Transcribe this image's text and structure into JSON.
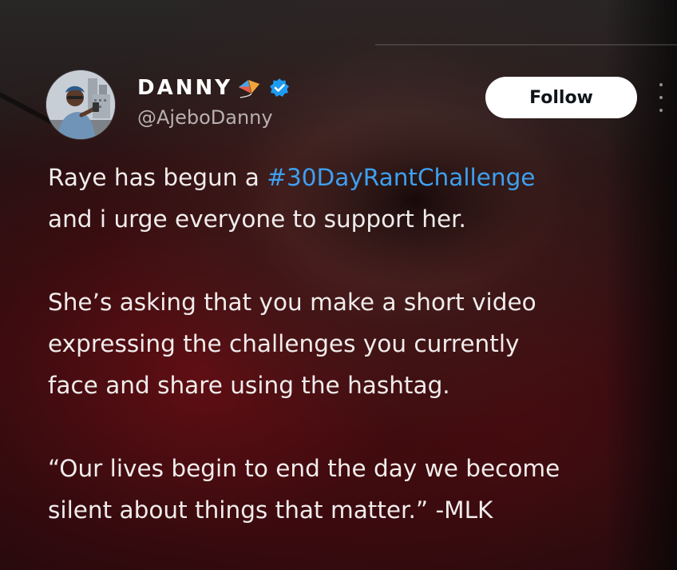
{
  "tweet": {
    "author": {
      "display_name": "DANNY",
      "handle": "@AjeboDanny",
      "name_emoji": "kite-emoji",
      "verified": true,
      "verified_color": "#1d9bf0"
    },
    "follow_label": "Follow",
    "more_icon": "more-options-icon",
    "body": {
      "p1_prefix": "Raye has begun a ",
      "p1_hashtag": "#30DayRantChallenge",
      "p1_suffix": "and i urge everyone to support her.",
      "p2_line1": "She’s asking that you make a short video",
      "p2_line2": "expressing the challenges you currently",
      "p2_line3": "face and share using the hashtag.",
      "p3_line1": "“Our lives begin to end the day we become",
      "p3_line2": "silent about things that matter.” -MLK"
    },
    "colors": {
      "hashtag": "#3ea0f0",
      "text": "#f1ecec",
      "handle": "#b8b0b0",
      "follow_bg": "#ffffff"
    }
  }
}
